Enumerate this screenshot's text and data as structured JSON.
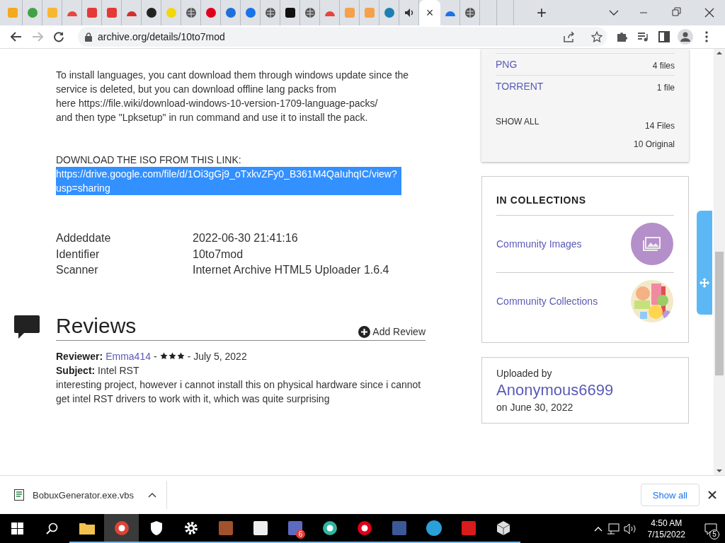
{
  "browser": {
    "tabs": [
      {
        "kind": "tile",
        "color": "#f4a81d",
        "selected": false
      },
      {
        "kind": "circle",
        "color": "#43a047",
        "selected": false
      },
      {
        "kind": "tile",
        "color": "#f7b731",
        "selected": false
      },
      {
        "kind": "arc",
        "color": "#e8453c",
        "selected": false
      },
      {
        "kind": "tile",
        "color": "#e53935",
        "selected": false
      },
      {
        "kind": "tile",
        "color": "#e53935",
        "selected": false
      },
      {
        "kind": "arc",
        "color": "#d32f2f",
        "selected": false
      },
      {
        "kind": "circle",
        "color": "#222222",
        "selected": false
      },
      {
        "kind": "circle",
        "color": "#f2d70a",
        "selected": false
      },
      {
        "kind": "globe",
        "color": "#555555",
        "selected": false
      },
      {
        "kind": "circle",
        "color": "#e0001b",
        "selected": false
      },
      {
        "kind": "circle",
        "color": "#1e6fd9",
        "selected": false
      },
      {
        "kind": "circle",
        "color": "#1a73e8",
        "selected": false
      },
      {
        "kind": "globe",
        "color": "#555555",
        "selected": false
      },
      {
        "kind": "tile",
        "color": "#111111",
        "selected": false
      },
      {
        "kind": "globe",
        "color": "#555555",
        "selected": false
      },
      {
        "kind": "arc",
        "color": "#e8453c",
        "selected": false
      },
      {
        "kind": "tile",
        "color": "#f5a04a",
        "selected": false
      },
      {
        "kind": "tile",
        "color": "#f5a04a",
        "selected": false
      },
      {
        "kind": "circle",
        "color": "#1a7fb4",
        "selected": false
      },
      {
        "kind": "speaker",
        "color": "#333333",
        "selected": false
      },
      {
        "kind": "close",
        "close": "×",
        "selected": true
      },
      {
        "kind": "arc",
        "color": "#1a73e8",
        "selected": false
      },
      {
        "kind": "globe",
        "color": "#555555",
        "selected": false
      },
      {
        "kind": "blank",
        "selected": false
      },
      {
        "kind": "blank",
        "selected": false
      }
    ],
    "new_tab": "+",
    "url": "archive.org/details/10to7mod"
  },
  "description": {
    "lines": [
      "To install languages, you cant download them through windows update since the",
      "service is deleted, but you can download offline lang packs from",
      "here https://file.wiki/download-windows-10-version-1709-language-packs/",
      "and then type \"Lpksetup\" in run command and use it to install the pack."
    ],
    "download_heading": "DOWNLOAD THE ISO FROM THIS LINK:",
    "link": {
      "text": "https://drive.google.com/file/d/1Oi3gGj9_oTxkvZFy0_B361M4QaIuhqIC/view?usp=sharing",
      "highlighted": true
    }
  },
  "metadata": [
    {
      "label": "Addeddate",
      "value": "2022-06-30 21:41:16"
    },
    {
      "label": "Identifier",
      "value": "10to7mod"
    },
    {
      "label": "Scanner",
      "value": "Internet Archive HTML5 Uploader 1.6.4"
    }
  ],
  "reviews": {
    "title": "Reviews",
    "add": "Add Review",
    "items": [
      {
        "reviewer_label": "Reviewer:",
        "reviewer": "Emma414",
        "separator": "-",
        "stars": 3,
        "date": "- July 5, 2022",
        "subject": "**Subject:** Intel RST",
        "body": "interesting project, however i cannot install this on physical hardware since i cannot get intel RST drivers to work with it, which was quite surprising"
      }
    ]
  },
  "files": {
    "rows": [
      {
        "format": "PNG",
        "count": "4 files"
      },
      {
        "format": "TORRENT",
        "count": "1 file"
      }
    ],
    "show_all": "SHOW ALL",
    "totals": [
      "14 Files",
      "10 Original"
    ]
  },
  "collections": {
    "title": "IN COLLECTIONS",
    "items": [
      {
        "name": "Community Images",
        "kind": "icon"
      },
      {
        "name": "Community Collections",
        "kind": "picture"
      }
    ]
  },
  "uploader": {
    "label": "Uploaded by",
    "name": "Anonymous6699",
    "date": "on June 30, 2022"
  },
  "download_bar": {
    "file": "BobuxGenerator.exe.vbs",
    "show_all": "Show all"
  },
  "taskbar": {
    "apps": [
      {
        "kind": "folder",
        "color": "#f2c14e",
        "selected": false
      },
      {
        "kind": "ring",
        "color": "#db4437",
        "selected": true
      },
      {
        "kind": "shield",
        "color": "#ffffff",
        "selected": false
      },
      {
        "kind": "gear",
        "color": "#ffffff",
        "selected": false
      },
      {
        "kind": "square",
        "color": "#a0522d",
        "selected": false
      },
      {
        "kind": "square",
        "color": "#eeeeee",
        "selected": false
      },
      {
        "kind": "square",
        "color": "#5c6bc0",
        "selected": false,
        "badge": "6"
      },
      {
        "kind": "ring",
        "color": "#2fb5a3",
        "selected": false
      },
      {
        "kind": "ring",
        "color": "#e0001b",
        "selected": false
      },
      {
        "kind": "square",
        "color": "#3b5998",
        "selected": false
      },
      {
        "kind": "circle",
        "color": "#2a9fd8",
        "selected": false
      },
      {
        "kind": "square",
        "color": "#d81b1b",
        "selected": false
      },
      {
        "kind": "cube",
        "color": "#dddddd",
        "selected": false
      }
    ],
    "time": "4:50 AM",
    "date": "7/15/2022",
    "notifications": "5"
  }
}
